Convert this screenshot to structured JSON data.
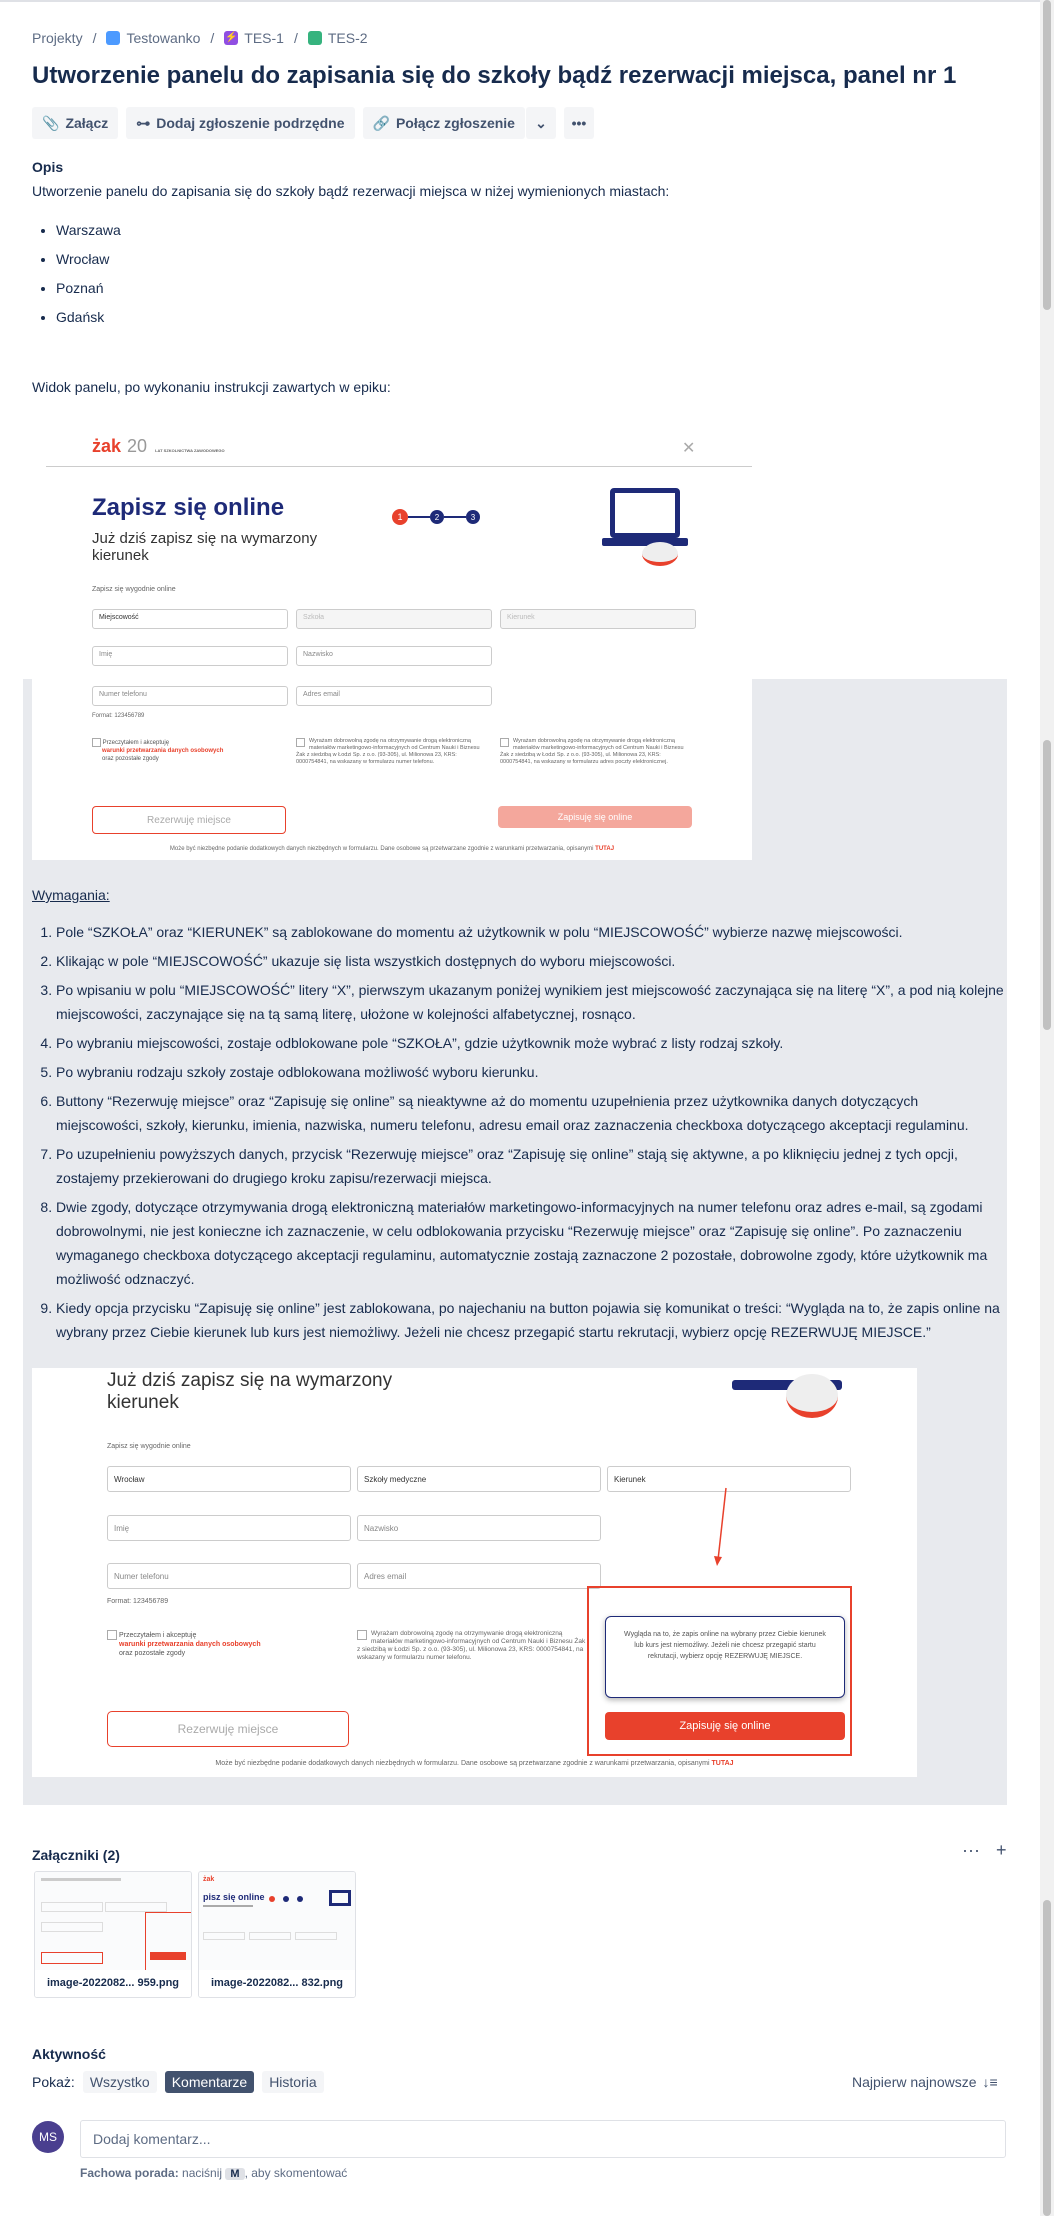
{
  "breadcrumb": {
    "projects": "Projekty",
    "project": "Testowanko",
    "epic": "TES-1",
    "issue": "TES-2"
  },
  "title": "Utworzenie panelu do zapisania się do szkoły bądź rezerwacji miejsca, panel nr 1",
  "toolbar": {
    "attach": "Załącz",
    "child": "Dodaj zgłoszenie podrzędne",
    "link": "Połącz zgłoszenie"
  },
  "description": {
    "heading": "Opis",
    "intro": "Utworzenie panelu do zapisania się do szkoły bądź rezerwacji miejsca w niżej wymienionych miastach:",
    "cities": [
      "Warszawa",
      "Wrocław",
      "Poznań",
      "Gdańsk"
    ],
    "view_text": "Widok panelu, po wykonaniu instrukcji zawartych w epiku:"
  },
  "shot1": {
    "logo": "żak",
    "logo_num": "20",
    "logo_sub": "LAT SZKOLNICTWA ZAWODOWEGO",
    "heading": "Zapisz się online",
    "sub1": "Już dziś zapisz się na wymarzony",
    "sub2": "kierunek",
    "steps": [
      "1",
      "2",
      "3"
    ],
    "form_label": "Zapisz się wygodnie online",
    "f_city": "Miejscowość",
    "f_school": "Szkoła",
    "f_course": "Kierunek",
    "f_name": "Imię",
    "f_surname": "Nazwisko",
    "f_phone": "Numer telefonu",
    "f_email": "Adres email",
    "hint": "Format: 123456789",
    "c1a": "Przeczytałem i akceptuję",
    "c1b": "warunki przetwarzania danych osobowych",
    "c1c": "oraz pozostałe zgody",
    "c2": "Wyrażam dobrowolną zgodę na otrzymywanie drogą elektroniczną materiałów marketingowo-informacyjnych od Centrum Nauki i Biznesu Żak z siedzibą w Łodzi Sp. z o.o. (93-305), ul. Milionowa 23, KRS: 0000754841, na wskazany w formularzu numer telefonu.",
    "c3": "Wyrażam dobrowolną zgodę na otrzymywanie drogą elektroniczną materiałów marketingowo-informacyjnych od Centrum Nauki i Biznesu Żak z siedzibą w Łodzi Sp. z o.o. (93-305), ul. Milionowa 23, KRS: 0000754841, na wskazany w formularzu adres poczty elektronicznej.",
    "btn_reserve": "Rezerwuję miejsce",
    "btn_signup": "Zapisuję się online",
    "footer": "Może być niezbędne podanie dodatkowych danych niezbędnych w formularzu. Dane osobowe są przetwarzane zgodnie z warunkami przetwarzania, opisanymi",
    "footer_link": "TUTAJ"
  },
  "requirements": {
    "heading": "Wymagania:",
    "items": [
      "Pole “SZKOŁA” oraz “KIERUNEK” są zablokowane do momentu aż użytkownik w polu “MIEJSCOWOŚĆ” wybierze nazwę miejscowości.",
      "Klikając w pole “MIEJSCOWOŚĆ” ukazuje się lista wszystkich dostępnych do wyboru miejscowości.",
      "Po wpisaniu w polu “MIEJSCOWOŚĆ” litery “X”, pierwszym ukazanym poniżej wynikiem jest miejscowość zaczynająca się na literę “X”, a pod nią kolejne miejscowości, zaczynające się na tą samą literę, ułożone w kolejności alfabetycznej, rosnąco.",
      "Po wybraniu miejscowości, zostaje odblokowane pole “SZKOŁA”, gdzie użytkownik może wybrać z listy rodzaj szkoły.",
      "Po wybraniu rodzaju szkoły zostaje odblokowana możliwość wyboru kierunku.",
      "Buttony “Rezerwuję miejsce” oraz “Zapisuję się online” są nieaktywne aż do momentu uzupełnienia przez użytkownika danych dotyczących miejscowości, szkoły, kierunku, imienia, nazwiska, numeru telefonu, adresu email oraz zaznaczenia checkboxa dotyczącego akceptacji regulaminu.",
      "Po uzupełnieniu powyższych danych, przycisk “Rezerwuję miejsce” oraz “Zapisuję się online” stają się aktywne, a po kliknięciu jednej z tych opcji, zostajemy przekierowani do drugiego kroku zapisu/rezerwacji miejsca.",
      "Dwie zgody, dotyczące otrzymywania drogą elektroniczną materiałów marketingowo-informacyjnych na numer telefonu oraz adres e-mail, są zgodami dobrowolnymi, nie jest konieczne ich zaznaczenie, w celu odblokowania przycisku “Rezerwuję miejsce” oraz “Zapisuję się online”.  Po zaznaczeniu wymaganego checkboxa dotyczącego akceptacji regulaminu, automatycznie zostają zaznaczone 2 pozostałe, dobrowolne zgody, które użytkownik ma możliwość odznaczyć.",
      "Kiedy opcja przycisku “Zapisuję się online” jest zablokowana, po najechaniu na button pojawia się komunikat o treści: “Wygląda na to, że zapis online na wybrany przez Ciebie kierunek lub kurs jest niemożliwy. Jeżeli nie chcesz przegapić startu rekrutacji, wybierz opcję REZERWUJĘ MIEJSCE.”"
    ]
  },
  "shot2": {
    "sub1": "Już dziś zapisz się na wymarzony",
    "sub2": "kierunek",
    "form_label": "Zapisz się wygodnie online",
    "f_city": "Wrocław",
    "f_school": "Szkoły medyczne",
    "f_course": "Kierunek",
    "f_name": "Imię",
    "f_surname": "Nazwisko",
    "f_phone": "Numer telefonu",
    "f_email": "Adres email",
    "hint": "Format: 123456789",
    "c1a": "Przeczytałem i akceptuję",
    "c1b": "warunki przetwarzania danych osobowych",
    "c1c": "oraz pozostałe zgody",
    "c2": "Wyrażam dobrowolną zgodę na otrzymywanie drogą elektroniczną materiałów marketingowo-informacyjnych od Centrum Nauki i Biznesu Żak z siedzibą w Łodzi Sp. z o.o. (93-305), ul. Milionowa 23, KRS: 0000754841, na wskazany w formularzu numer telefonu.",
    "tooltip": "Wygląda na to, że zapis online na wybrany przez Ciebie kierunek lub kurs jest niemożliwy. Jeżeli nie chcesz przegapić startu rekrutacji, wybierz opcję REZERWUJĘ MIEJSCE.",
    "btn_reserve": "Rezerwuję miejsce",
    "btn_signup": "Zapisuję się online",
    "footer": "Może być niezbędne podanie dodatkowych danych niezbędnych w formularzu. Dane osobowe są przetwarzane zgodnie z warunkami przetwarzania, opisanymi",
    "footer_link": "TUTAJ"
  },
  "attachments": {
    "heading": "Załączniki (2)",
    "files": [
      {
        "name": "image-2022082... 959.png"
      },
      {
        "name": "image-2022082... 832.png"
      }
    ]
  },
  "activity": {
    "heading": "Aktywność",
    "show": "Pokaż:",
    "filters": [
      "Wszystko",
      "Komentarze",
      "Historia"
    ],
    "sort": "Najpierw najnowsze",
    "avatar": "MS",
    "placeholder": "Dodaj komentarz...",
    "tip_label": "Fachowa porada:",
    "tip_pre": "naciśnij",
    "tip_key": "M",
    "tip_post": ", aby skomentować"
  },
  "colors": {
    "accent": "#e8412c",
    "text": "#172b4d",
    "link": "#0052cc"
  }
}
